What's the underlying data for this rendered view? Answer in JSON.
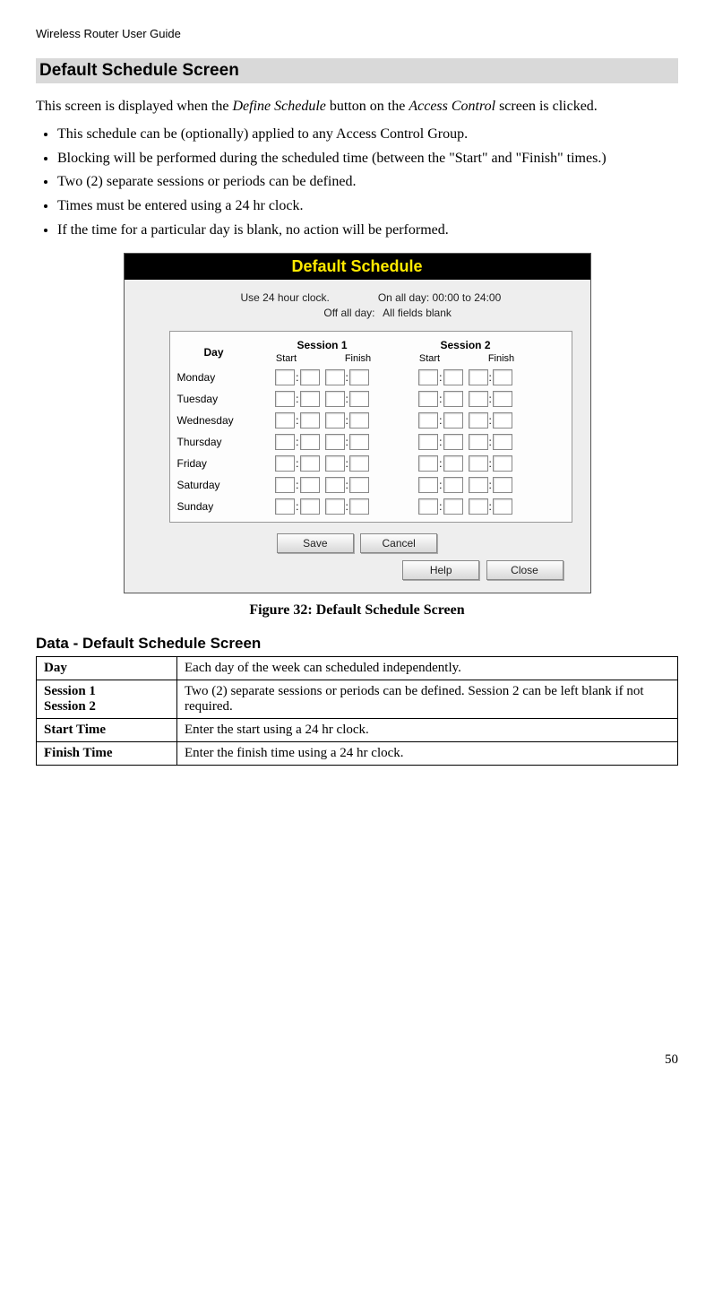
{
  "header": "Wireless Router User Guide",
  "section_title": "Default Schedule Screen",
  "intro": {
    "pre": "This screen is displayed when the ",
    "em1": "Define Schedule",
    "mid": " button on the ",
    "em2": "Access Control",
    "post": " screen is clicked."
  },
  "bullets": [
    "This schedule can be (optionally) applied to any Access Control Group.",
    "Blocking will be performed during the scheduled time (between the \"Start\" and \"Finish\" times.)",
    "Two (2) separate sessions or periods can be defined.",
    "Times must be entered using a 24 hr clock.",
    "If the time for a particular day is blank, no action will be performed."
  ],
  "app": {
    "title": "Default Schedule",
    "hint_a1": "Use 24 hour clock.",
    "hint_a2": "On all day: 00:00 to 24:00",
    "hint_b1": "Off all day:",
    "hint_b2": "All fields blank",
    "col_day": "Day",
    "sessions": [
      {
        "title": "Session 1",
        "sub1": "Start",
        "sub2": "Finish"
      },
      {
        "title": "Session 2",
        "sub1": "Start",
        "sub2": "Finish"
      }
    ],
    "days": [
      "Monday",
      "Tuesday",
      "Wednesday",
      "Thursday",
      "Friday",
      "Saturday",
      "Sunday"
    ],
    "btn_save": "Save",
    "btn_cancel": "Cancel",
    "btn_help": "Help",
    "btn_close": "Close"
  },
  "figure_caption": "Figure 32: Default Schedule Screen",
  "data_section_title": "Data - Default Schedule Screen",
  "data_table": [
    {
      "label": "Day",
      "desc": "Each day of the week can scheduled independently."
    },
    {
      "label": "Session 1\nSession 2",
      "desc": "Two (2) separate sessions or periods can be defined. Session 2 can be left blank if not required."
    },
    {
      "label": "Start Time",
      "desc": "Enter the start using a 24 hr clock."
    },
    {
      "label": "Finish Time",
      "desc": "Enter the finish time using a 24 hr clock."
    }
  ],
  "page_number": "50"
}
